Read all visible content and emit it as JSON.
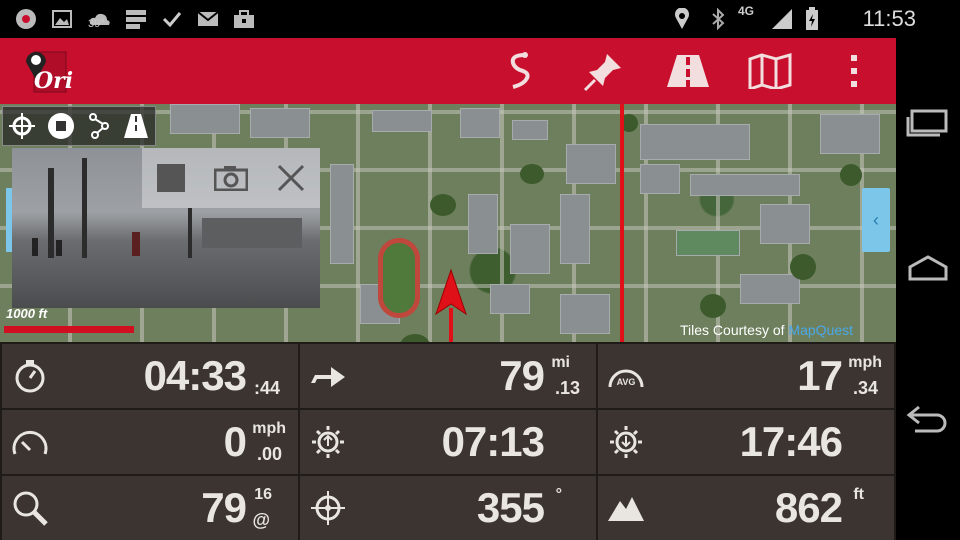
{
  "status_bar": {
    "time": "11:53",
    "temperature": "39°",
    "network": "4G",
    "icons": [
      "record-icon",
      "image-icon",
      "weather-icon",
      "storage-icon",
      "check-icon",
      "gmail-icon",
      "briefcase-icon",
      "location-icon",
      "bluetooth-icon",
      "signal-icon",
      "battery-icon"
    ]
  },
  "app_bar": {
    "logo_text": "Ori",
    "actions": [
      "route-icon",
      "pin-icon",
      "road-icon",
      "map-icon",
      "overflow-menu-icon"
    ]
  },
  "map": {
    "scale_label": "1000 ft",
    "attribution_prefix": "Tiles Courtesy of ",
    "attribution_link": "MapQuest",
    "side_tab_glyph": "‹",
    "tools": [
      "crosshair-icon",
      "stop-icon",
      "waypoints-icon",
      "road-icon"
    ],
    "camera_controls": [
      "stop-icon",
      "camera-icon",
      "close-icon"
    ]
  },
  "dashboard": {
    "cells": [
      {
        "icon": "stopwatch-icon",
        "value": "04:33",
        "unit_top": "",
        "unit_bottom": ":44"
      },
      {
        "icon": "distance-arrow-icon",
        "value": "79",
        "unit_top": "mi",
        "unit_bottom": ".13"
      },
      {
        "icon": "avg-speed-icon",
        "value": "17",
        "unit_top": "mph",
        "unit_bottom": ".34",
        "icon_label": "AVG"
      },
      {
        "icon": "speedometer-icon",
        "value": "0",
        "unit_top": "mph",
        "unit_bottom": ".00"
      },
      {
        "icon": "sunrise-icon",
        "value": "07:13",
        "unit_top": "",
        "unit_bottom": ""
      },
      {
        "icon": "sunset-icon",
        "value": "17:46",
        "unit_top": "",
        "unit_bottom": ""
      },
      {
        "icon": "search-icon",
        "value": "79",
        "unit_top": "16",
        "unit_bottom": "@"
      },
      {
        "icon": "compass-icon",
        "value": "355",
        "unit_top": "°",
        "unit_bottom": ""
      },
      {
        "icon": "elevation-icon",
        "value": "862",
        "unit_top": "ft",
        "unit_bottom": ""
      }
    ]
  },
  "colors": {
    "app_bar": "#c8102e",
    "dashboard_cell": "#3b3430",
    "route": "#e01018",
    "link": "#4aa8e8"
  }
}
